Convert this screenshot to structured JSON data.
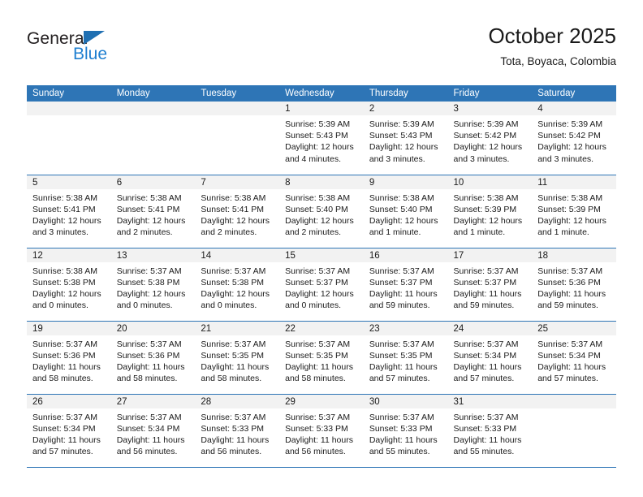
{
  "logo": {
    "word_top": "General",
    "word_bottom": "Blue",
    "triangle": "triangle-icon",
    "color_dark": "#231f20",
    "color_blue": "#1f7fd0"
  },
  "header": {
    "title": "October 2025",
    "subtitle": "Tota, Boyaca, Colombia"
  },
  "theme": {
    "header_blue": "#2e75b6",
    "daynum_band": "#f2f2f2",
    "text": "#1a1a1a"
  },
  "calendar": {
    "weekday_headers": [
      "Sunday",
      "Monday",
      "Tuesday",
      "Wednesday",
      "Thursday",
      "Friday",
      "Saturday"
    ],
    "labels": {
      "sunrise": "Sunrise:",
      "sunset": "Sunset:",
      "daylight": "Daylight:"
    },
    "weeks": [
      [
        {
          "day": "",
          "empty": true
        },
        {
          "day": "",
          "empty": true
        },
        {
          "day": "",
          "empty": true
        },
        {
          "day": "1",
          "sunrise": "Sunrise: 5:39 AM",
          "sunset": "Sunset: 5:43 PM",
          "daylight": "Daylight: 12 hours and 4 minutes."
        },
        {
          "day": "2",
          "sunrise": "Sunrise: 5:39 AM",
          "sunset": "Sunset: 5:43 PM",
          "daylight": "Daylight: 12 hours and 3 minutes."
        },
        {
          "day": "3",
          "sunrise": "Sunrise: 5:39 AM",
          "sunset": "Sunset: 5:42 PM",
          "daylight": "Daylight: 12 hours and 3 minutes."
        },
        {
          "day": "4",
          "sunrise": "Sunrise: 5:39 AM",
          "sunset": "Sunset: 5:42 PM",
          "daylight": "Daylight: 12 hours and 3 minutes."
        }
      ],
      [
        {
          "day": "5",
          "sunrise": "Sunrise: 5:38 AM",
          "sunset": "Sunset: 5:41 PM",
          "daylight": "Daylight: 12 hours and 3 minutes."
        },
        {
          "day": "6",
          "sunrise": "Sunrise: 5:38 AM",
          "sunset": "Sunset: 5:41 PM",
          "daylight": "Daylight: 12 hours and 2 minutes."
        },
        {
          "day": "7",
          "sunrise": "Sunrise: 5:38 AM",
          "sunset": "Sunset: 5:41 PM",
          "daylight": "Daylight: 12 hours and 2 minutes."
        },
        {
          "day": "8",
          "sunrise": "Sunrise: 5:38 AM",
          "sunset": "Sunset: 5:40 PM",
          "daylight": "Daylight: 12 hours and 2 minutes."
        },
        {
          "day": "9",
          "sunrise": "Sunrise: 5:38 AM",
          "sunset": "Sunset: 5:40 PM",
          "daylight": "Daylight: 12 hours and 1 minute."
        },
        {
          "day": "10",
          "sunrise": "Sunrise: 5:38 AM",
          "sunset": "Sunset: 5:39 PM",
          "daylight": "Daylight: 12 hours and 1 minute."
        },
        {
          "day": "11",
          "sunrise": "Sunrise: 5:38 AM",
          "sunset": "Sunset: 5:39 PM",
          "daylight": "Daylight: 12 hours and 1 minute."
        }
      ],
      [
        {
          "day": "12",
          "sunrise": "Sunrise: 5:38 AM",
          "sunset": "Sunset: 5:38 PM",
          "daylight": "Daylight: 12 hours and 0 minutes."
        },
        {
          "day": "13",
          "sunrise": "Sunrise: 5:37 AM",
          "sunset": "Sunset: 5:38 PM",
          "daylight": "Daylight: 12 hours and 0 minutes."
        },
        {
          "day": "14",
          "sunrise": "Sunrise: 5:37 AM",
          "sunset": "Sunset: 5:38 PM",
          "daylight": "Daylight: 12 hours and 0 minutes."
        },
        {
          "day": "15",
          "sunrise": "Sunrise: 5:37 AM",
          "sunset": "Sunset: 5:37 PM",
          "daylight": "Daylight: 12 hours and 0 minutes."
        },
        {
          "day": "16",
          "sunrise": "Sunrise: 5:37 AM",
          "sunset": "Sunset: 5:37 PM",
          "daylight": "Daylight: 11 hours and 59 minutes."
        },
        {
          "day": "17",
          "sunrise": "Sunrise: 5:37 AM",
          "sunset": "Sunset: 5:37 PM",
          "daylight": "Daylight: 11 hours and 59 minutes."
        },
        {
          "day": "18",
          "sunrise": "Sunrise: 5:37 AM",
          "sunset": "Sunset: 5:36 PM",
          "daylight": "Daylight: 11 hours and 59 minutes."
        }
      ],
      [
        {
          "day": "19",
          "sunrise": "Sunrise: 5:37 AM",
          "sunset": "Sunset: 5:36 PM",
          "daylight": "Daylight: 11 hours and 58 minutes."
        },
        {
          "day": "20",
          "sunrise": "Sunrise: 5:37 AM",
          "sunset": "Sunset: 5:36 PM",
          "daylight": "Daylight: 11 hours and 58 minutes."
        },
        {
          "day": "21",
          "sunrise": "Sunrise: 5:37 AM",
          "sunset": "Sunset: 5:35 PM",
          "daylight": "Daylight: 11 hours and 58 minutes."
        },
        {
          "day": "22",
          "sunrise": "Sunrise: 5:37 AM",
          "sunset": "Sunset: 5:35 PM",
          "daylight": "Daylight: 11 hours and 58 minutes."
        },
        {
          "day": "23",
          "sunrise": "Sunrise: 5:37 AM",
          "sunset": "Sunset: 5:35 PM",
          "daylight": "Daylight: 11 hours and 57 minutes."
        },
        {
          "day": "24",
          "sunrise": "Sunrise: 5:37 AM",
          "sunset": "Sunset: 5:34 PM",
          "daylight": "Daylight: 11 hours and 57 minutes."
        },
        {
          "day": "25",
          "sunrise": "Sunrise: 5:37 AM",
          "sunset": "Sunset: 5:34 PM",
          "daylight": "Daylight: 11 hours and 57 minutes."
        }
      ],
      [
        {
          "day": "26",
          "sunrise": "Sunrise: 5:37 AM",
          "sunset": "Sunset: 5:34 PM",
          "daylight": "Daylight: 11 hours and 57 minutes."
        },
        {
          "day": "27",
          "sunrise": "Sunrise: 5:37 AM",
          "sunset": "Sunset: 5:34 PM",
          "daylight": "Daylight: 11 hours and 56 minutes."
        },
        {
          "day": "28",
          "sunrise": "Sunrise: 5:37 AM",
          "sunset": "Sunset: 5:33 PM",
          "daylight": "Daylight: 11 hours and 56 minutes."
        },
        {
          "day": "29",
          "sunrise": "Sunrise: 5:37 AM",
          "sunset": "Sunset: 5:33 PM",
          "daylight": "Daylight: 11 hours and 56 minutes."
        },
        {
          "day": "30",
          "sunrise": "Sunrise: 5:37 AM",
          "sunset": "Sunset: 5:33 PM",
          "daylight": "Daylight: 11 hours and 55 minutes."
        },
        {
          "day": "31",
          "sunrise": "Sunrise: 5:37 AM",
          "sunset": "Sunset: 5:33 PM",
          "daylight": "Daylight: 11 hours and 55 minutes."
        },
        {
          "day": "",
          "empty": true
        }
      ]
    ]
  }
}
